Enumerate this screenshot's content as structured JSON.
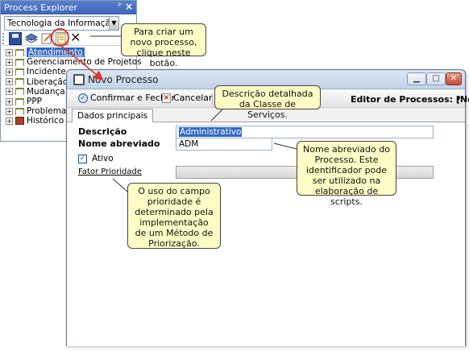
{
  "process_explorer": {
    "title": "Process Explorer",
    "pin_glyph": "ᵖ",
    "close_glyph": "✕",
    "combo_value": "Tecnologia da Informação",
    "tree_items": [
      {
        "label": "Atendimento",
        "icon": "process-node-icon",
        "selected": true
      },
      {
        "label": "Gerenciamento de Projetos",
        "icon": "process-node-icon"
      },
      {
        "label": "Incidente",
        "icon": "process-node-icon"
      },
      {
        "label": "Liberação",
        "icon": "process-node-icon"
      },
      {
        "label": "Mudança",
        "icon": "process-node-icon"
      },
      {
        "label": "PPP",
        "icon": "process-node-icon"
      },
      {
        "label": "Problema",
        "icon": "process-node-icon"
      },
      {
        "label": "Histórico de",
        "icon": "book-icon"
      }
    ],
    "expand_glyph": "+"
  },
  "window": {
    "title": "Novo Processo",
    "toolbar": {
      "confirm_label": "Confirmar e Fechar",
      "cancel_label": "Cancelar",
      "editor_label": "Editor de Processos: [Novo]"
    },
    "tabs": [
      {
        "label": "Dados principais"
      }
    ],
    "form": {
      "descricao_label": "Descrição",
      "descricao_value": "Administrativo",
      "nome_abreviado_label": "Nome abreviado",
      "nome_abreviado_value": "ADM",
      "ativo_label": "Ativo",
      "ativo_checked": true,
      "fator_prioridade_label": "Fator Prioridade"
    }
  },
  "callouts": {
    "new_process": "Para criar um novo processo, clique neste botão.",
    "descricao": "Descrição detalhada da Classe de Serviços.",
    "nome_abreviado": "Nome abreviado do Processo. Este identificador pode ser utilizado na elaboração de scripts.",
    "fator_prioridade": "O uso do campo prioridade é determinado pela implementação de um Método de Priorização."
  },
  "colors": {
    "callout_bg": "#fffbc4",
    "highlight_red": "#e03030",
    "selection_blue": "#316ac5"
  }
}
